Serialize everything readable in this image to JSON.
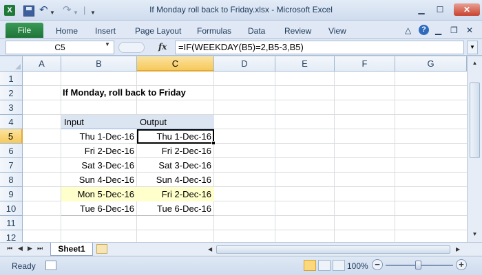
{
  "window": {
    "title": "If Monday roll back to Friday.xlsx  -  Microsoft Excel",
    "app_icon": "X"
  },
  "ribbon": {
    "file_label": "File",
    "tabs": [
      "Home",
      "Insert",
      "Page Layout",
      "Formulas",
      "Data",
      "Review",
      "View"
    ],
    "help_label": "?"
  },
  "formula_bar": {
    "name_box": "C5",
    "fx_label": "fx",
    "formula": "=IF(WEEKDAY(B5)=2,B5-3,B5)"
  },
  "grid": {
    "columns": [
      "A",
      "B",
      "C",
      "D",
      "E",
      "F",
      "G"
    ],
    "rows": [
      "1",
      "2",
      "3",
      "4",
      "5",
      "6",
      "7",
      "8",
      "9",
      "10",
      "11",
      "12"
    ],
    "active_cell": "C5",
    "title": "If Monday, roll back to Friday",
    "table": {
      "headers": [
        "Input",
        "Output"
      ],
      "rows": [
        [
          "Thu 1-Dec-16",
          "Thu 1-Dec-16"
        ],
        [
          "Fri 2-Dec-16",
          "Fri 2-Dec-16"
        ],
        [
          "Sat 3-Dec-16",
          "Sat 3-Dec-16"
        ],
        [
          "Sun 4-Dec-16",
          "Sun 4-Dec-16"
        ],
        [
          "Mon 5-Dec-16",
          "Fri 2-Dec-16"
        ],
        [
          "Tue 6-Dec-16",
          "Tue 6-Dec-16"
        ]
      ],
      "highlight_row_index": 4,
      "highlight_color": "#ffffcc",
      "header_color": "#dbe5f1"
    }
  },
  "sheets": {
    "tabs": [
      "Sheet1"
    ]
  },
  "status_bar": {
    "status": "Ready",
    "zoom": "100%",
    "zoom_out_label": "−",
    "zoom_in_label": "+"
  },
  "colors": {
    "accent": "#1f7438",
    "selection_header": "#f6c95a"
  }
}
